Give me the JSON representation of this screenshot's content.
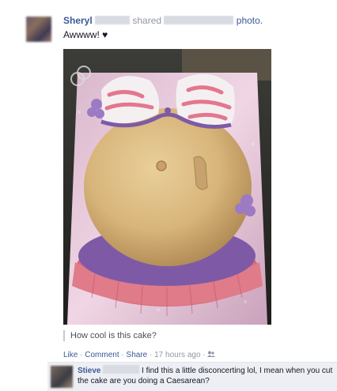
{
  "post": {
    "author": "Sheryl",
    "verb": "shared",
    "object": "photo.",
    "text": "Awwww! ♥"
  },
  "photo": {
    "subject": "pregnant-belly-cake",
    "caption": "How cool is this cake?"
  },
  "actions": {
    "like": "Like",
    "comment": "Comment",
    "share": "Share",
    "separator": "·",
    "time": "17 hours ago",
    "audience_icon": "people-icon"
  },
  "comment": {
    "author": "Stieve",
    "text": "I find this a little disconcerting lol, I mean when you cut the cake are you doing a Caesarean?"
  },
  "colors": {
    "link": "#3b5998",
    "meta": "#9197a3",
    "comment_bg": "#edeff4"
  }
}
